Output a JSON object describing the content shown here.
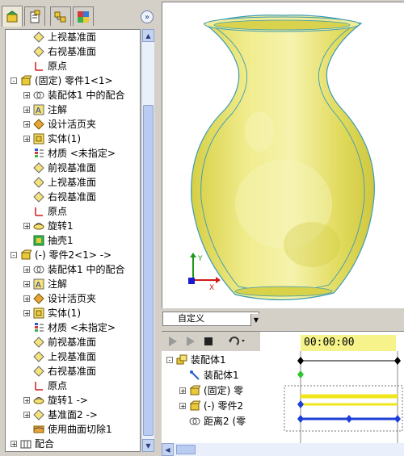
{
  "left_panel": {
    "tabs": [
      "feature-manager-tab",
      "property-manager-tab",
      "configuration-manager-tab",
      "display-manager-tab"
    ],
    "expand_symbol": "»",
    "tree": [
      {
        "label": "上视基准面",
        "icon": "plane-icon",
        "indent": 1,
        "expander": ""
      },
      {
        "label": "右视基准面",
        "icon": "plane-icon",
        "indent": 1,
        "expander": ""
      },
      {
        "label": "原点",
        "icon": "origin-icon",
        "indent": 1,
        "expander": ""
      },
      {
        "label": "(固定) 零件1<1>",
        "icon": "part-icon",
        "indent": 0,
        "expander": "−"
      },
      {
        "label": "装配体1 中的配合",
        "icon": "mate-icon",
        "indent": 1,
        "expander": "+"
      },
      {
        "label": "注解",
        "icon": "annotation-icon",
        "indent": 1,
        "expander": "+"
      },
      {
        "label": "设计活页夹",
        "icon": "binder-icon",
        "indent": 1,
        "expander": "+"
      },
      {
        "label": "实体(1)",
        "icon": "solid-body-icon",
        "indent": 1,
        "expander": "+"
      },
      {
        "label": "材质 <未指定>",
        "icon": "material-icon",
        "indent": 1,
        "expander": ""
      },
      {
        "label": "前视基准面",
        "icon": "plane-icon",
        "indent": 1,
        "expander": ""
      },
      {
        "label": "上视基准面",
        "icon": "plane-icon",
        "indent": 1,
        "expander": ""
      },
      {
        "label": "右视基准面",
        "icon": "plane-icon",
        "indent": 1,
        "expander": ""
      },
      {
        "label": "原点",
        "icon": "origin-icon",
        "indent": 1,
        "expander": ""
      },
      {
        "label": "旋转1",
        "icon": "revolve-icon",
        "indent": 1,
        "expander": "+"
      },
      {
        "label": "抽壳1",
        "icon": "shell-icon",
        "indent": 1,
        "expander": ""
      },
      {
        "label": "(-) 零件2<1> ->",
        "icon": "part-icon",
        "indent": 0,
        "expander": "−"
      },
      {
        "label": "装配体1 中的配合",
        "icon": "mate-icon",
        "indent": 1,
        "expander": "+"
      },
      {
        "label": "注解",
        "icon": "annotation-icon",
        "indent": 1,
        "expander": "+"
      },
      {
        "label": "设计活页夹",
        "icon": "binder-icon",
        "indent": 1,
        "expander": "+"
      },
      {
        "label": "实体(1)",
        "icon": "solid-body-icon",
        "indent": 1,
        "expander": "+"
      },
      {
        "label": "材质 <未指定>",
        "icon": "material-icon",
        "indent": 1,
        "expander": ""
      },
      {
        "label": "前视基准面",
        "icon": "plane-icon",
        "indent": 1,
        "expander": ""
      },
      {
        "label": "上视基准面",
        "icon": "plane-icon",
        "indent": 1,
        "expander": ""
      },
      {
        "label": "右视基准面",
        "icon": "plane-icon",
        "indent": 1,
        "expander": ""
      },
      {
        "label": "原点",
        "icon": "origin-icon",
        "indent": 1,
        "expander": ""
      },
      {
        "label": "旋转1 ->",
        "icon": "revolve-icon",
        "indent": 1,
        "expander": "+"
      },
      {
        "label": "基准面2 ->",
        "icon": "plane-icon",
        "indent": 1,
        "expander": "+"
      },
      {
        "label": "使用曲面切除1",
        "icon": "surface-cut-icon",
        "indent": 1,
        "expander": ""
      },
      {
        "label": "配合",
        "icon": "mates-folder-icon",
        "indent": 0,
        "expander": "+"
      }
    ]
  },
  "viewport": {
    "model": "vase",
    "colors": {
      "body": "#e8e36a",
      "edge": "#3a9bb5",
      "highlight": "#f4f1a8",
      "shadow": "#c9c23c"
    },
    "triad": {
      "x_color": "#d11a1a",
      "y_color": "#1a9a1a",
      "z_color": "#1a1ad1"
    }
  },
  "view_tab": {
    "label": "自定义",
    "dropdown_symbol": "▼"
  },
  "motion_study": {
    "time_header": "00:00:00",
    "tree": [
      {
        "label": "装配体1",
        "icon": "assembly-icon",
        "indent": 0,
        "expander": "−"
      },
      {
        "label": "装配体1",
        "icon": "orientation-icon",
        "indent": 1,
        "expander": ""
      },
      {
        "label": "(固定) 零",
        "icon": "part-icon",
        "indent": 1,
        "expander": "+"
      },
      {
        "label": "(-) 零件2",
        "icon": "part-icon",
        "indent": 1,
        "expander": "+"
      },
      {
        "label": "距离2 (零",
        "icon": "mate-icon",
        "indent": 1,
        "expander": ""
      }
    ],
    "track_colors": {
      "header": "#f5f38a",
      "yellow_bar": "#f0e61c",
      "blue_bar": "#1b3fd8",
      "key_green": "#2ec62e"
    }
  }
}
